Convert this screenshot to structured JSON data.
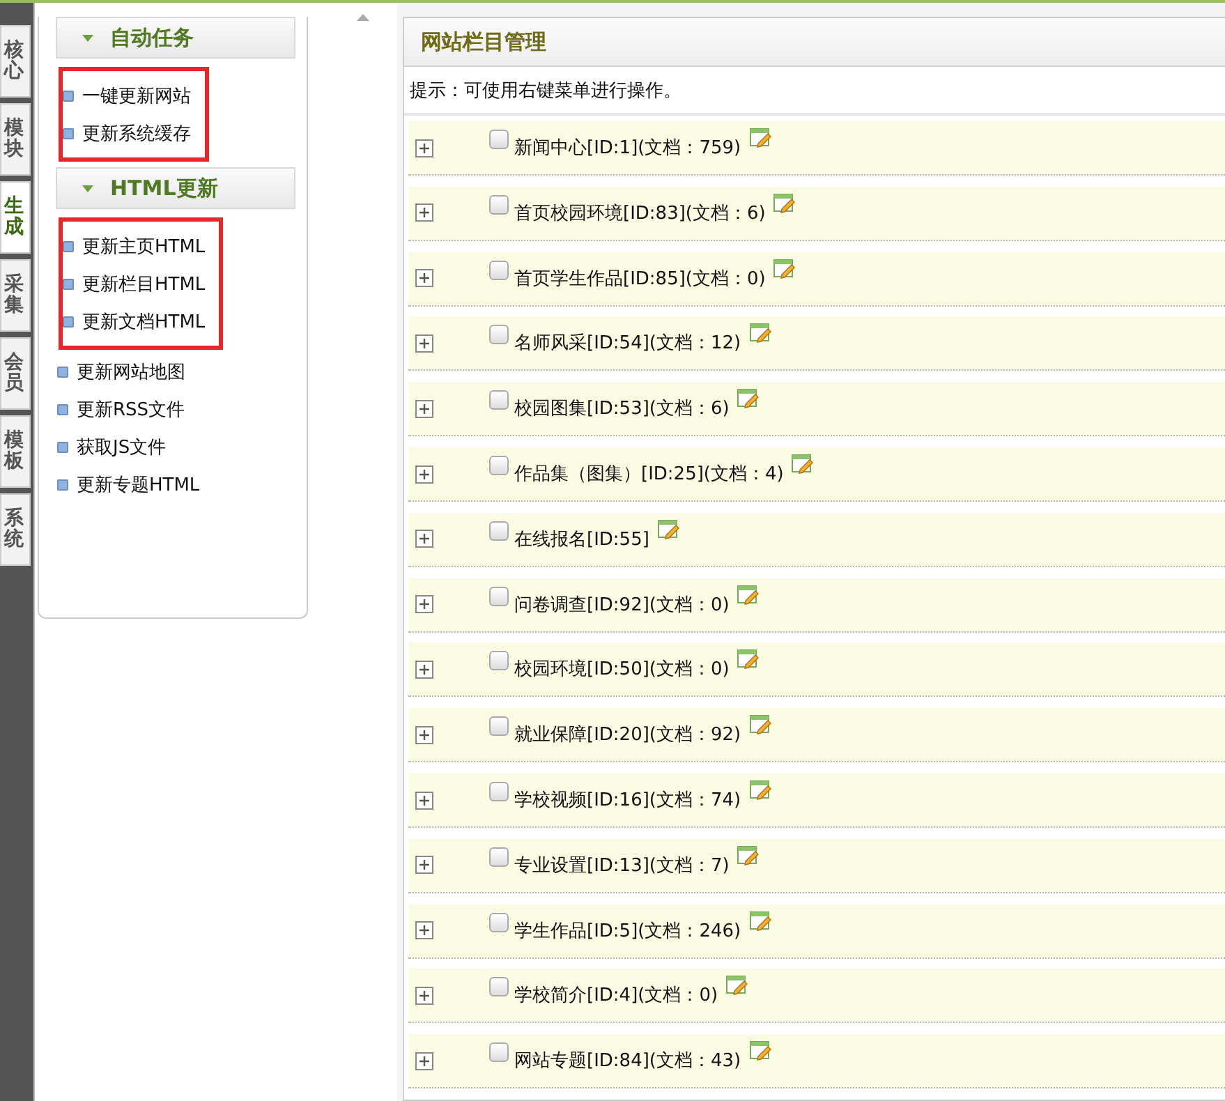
{
  "side_tabs": [
    {
      "label": "核心",
      "selected": false
    },
    {
      "label": "模块",
      "selected": false
    },
    {
      "label": "生成",
      "selected": true
    },
    {
      "label": "采集",
      "selected": false
    },
    {
      "label": "会员",
      "selected": false
    },
    {
      "label": "模板",
      "selected": false
    },
    {
      "label": "系统",
      "selected": false
    }
  ],
  "sidebar": {
    "sections": [
      {
        "title": "自动任务",
        "expanded": true,
        "blocks": [
          {
            "highlighted": true,
            "items": [
              "一键更新网站",
              "更新系统缓存"
            ]
          }
        ]
      },
      {
        "title": "HTML更新",
        "expanded": true,
        "blocks": [
          {
            "highlighted": true,
            "items": [
              "更新主页HTML",
              "更新栏目HTML",
              "更新文档HTML"
            ]
          },
          {
            "highlighted": false,
            "items": [
              "更新网站地图",
              "更新RSS文件",
              "获取JS文件",
              "更新专题HTML"
            ]
          }
        ]
      }
    ]
  },
  "panel": {
    "title": "网站栏目管理",
    "hint": "提示：可使用右键菜单进行操作。",
    "rows": [
      {
        "label": "新闻中心[ID:1](文档：759)",
        "expanded": false,
        "checked": false
      },
      {
        "label": "首页校园环境[ID:83](文档：6)",
        "expanded": false,
        "checked": false
      },
      {
        "label": "首页学生作品[ID:85](文档：0)",
        "expanded": false,
        "checked": false
      },
      {
        "label": "名师风采[ID:54](文档：12)",
        "expanded": false,
        "checked": false
      },
      {
        "label": "校园图集[ID:53](文档：6)",
        "expanded": false,
        "checked": false
      },
      {
        "label": "作品集（图集）[ID:25](文档：4)",
        "expanded": false,
        "checked": false
      },
      {
        "label": "在线报名[ID:55]",
        "expanded": false,
        "checked": false
      },
      {
        "label": "问卷调查[ID:92](文档：0)",
        "expanded": false,
        "checked": false
      },
      {
        "label": "校园环境[ID:50](文档：0)",
        "expanded": false,
        "checked": false
      },
      {
        "label": "就业保障[ID:20](文档：92)",
        "expanded": false,
        "checked": false
      },
      {
        "label": "学校视频[ID:16](文档：74)",
        "expanded": false,
        "checked": false
      },
      {
        "label": "专业设置[ID:13](文档：7)",
        "expanded": false,
        "checked": false
      },
      {
        "label": "学生作品[ID:5](文档：246)",
        "expanded": false,
        "checked": false
      },
      {
        "label": "学校简介[ID:4](文档：0)",
        "expanded": false,
        "checked": false
      },
      {
        "label": "网站专题[ID:84](文档：43)",
        "expanded": false,
        "checked": false
      }
    ]
  }
}
